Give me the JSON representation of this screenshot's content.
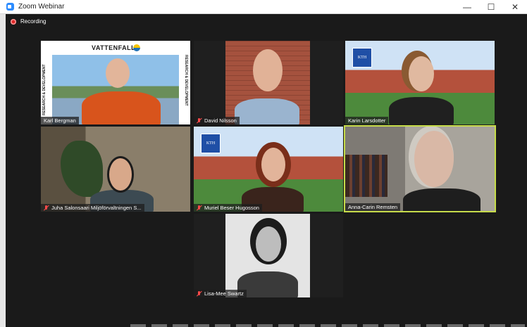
{
  "window": {
    "title": "Zoom Webinar",
    "controls": {
      "minimize": "—",
      "maximize": "☐",
      "close": "✕"
    }
  },
  "recording": {
    "label": "Recording"
  },
  "tiles": [
    {
      "name": "Karl Bergman",
      "muted": false,
      "active": false,
      "background_text": "VATTENFALL",
      "side_text": "RESEARCH & DEVELOPMENT"
    },
    {
      "name": "David Nilsson",
      "muted": true,
      "active": false
    },
    {
      "name": "Karin Larsdotter",
      "muted": false,
      "active": false,
      "logo_text": "KTH"
    },
    {
      "name": "Juha Salonsaari Miljöförvaltningen S...",
      "muted": true,
      "active": false
    },
    {
      "name": "Muriel Beser Hugosson",
      "muted": true,
      "active": false,
      "logo_text": "KTH"
    },
    {
      "name": "Anna-Carin Remsten",
      "muted": false,
      "active": true
    },
    {
      "name": "Lisa-Mee Swartz",
      "muted": true,
      "active": false
    }
  ],
  "colors": {
    "active_border": "#c7dc4a",
    "recording_red": "#e02828",
    "zoom_blue": "#2d8cff"
  }
}
